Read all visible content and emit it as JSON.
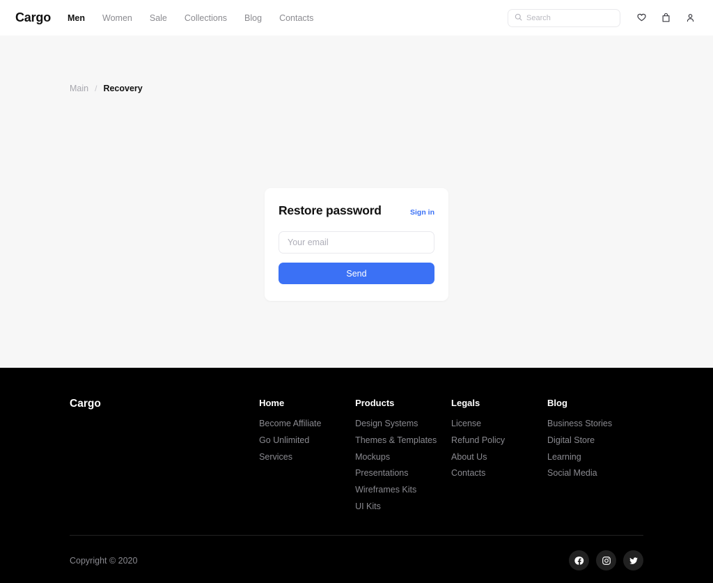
{
  "header": {
    "brand": "Cargo",
    "nav": [
      {
        "label": "Men",
        "active": true
      },
      {
        "label": "Women",
        "active": false
      },
      {
        "label": "Sale",
        "active": false
      },
      {
        "label": "Collections",
        "active": false
      },
      {
        "label": "Blog",
        "active": false
      },
      {
        "label": "Contacts",
        "active": false
      }
    ],
    "search": {
      "placeholder": "Search",
      "value": "",
      "icon": "search-icon"
    },
    "icons": [
      {
        "name": "heart-icon"
      },
      {
        "name": "bag-icon"
      },
      {
        "name": "user-icon"
      }
    ]
  },
  "breadcrumb": {
    "root": "Main",
    "separator": "/",
    "current": "Recovery"
  },
  "card": {
    "title": "Restore password",
    "signin_label": "Sign in",
    "email_placeholder": "Your email",
    "email_value": "",
    "send_label": "Send",
    "accent_color": "#3b71f5"
  },
  "footer": {
    "brand": "Cargo",
    "columns": [
      {
        "title": "Home",
        "links": [
          "Become Affiliate",
          "Go Unlimited",
          "Services"
        ]
      },
      {
        "title": "Products",
        "links": [
          "Design Systems",
          "Themes & Templates",
          "Mockups",
          "Presentations",
          "Wireframes Kits",
          "UI Kits"
        ]
      },
      {
        "title": "Legals",
        "links": [
          "License",
          "Refund Policy",
          "About Us",
          "Contacts"
        ]
      },
      {
        "title": "Blog",
        "links": [
          "Business Stories",
          "Digital Store",
          "Learning",
          "Social Media"
        ]
      }
    ],
    "copyright": "Copyright © 2020",
    "socials": [
      {
        "name": "facebook-icon"
      },
      {
        "name": "instagram-icon"
      },
      {
        "name": "twitter-icon"
      }
    ],
    "background_color": "#000000"
  },
  "colors": {
    "page_background": "#f7f7f7",
    "header_background": "#ffffff",
    "accent": "#3b71f5",
    "muted_text": "#8a8a90"
  }
}
